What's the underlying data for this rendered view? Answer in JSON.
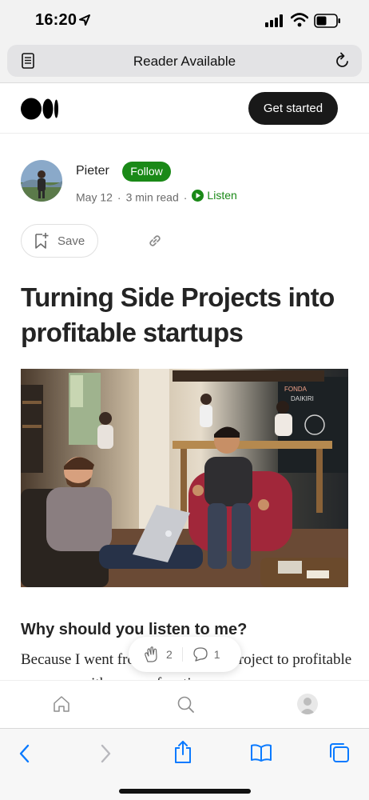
{
  "status_bar": {
    "time": "16:20",
    "icons": [
      "location-arrow-icon",
      "cellular-signal-icon",
      "wifi-icon",
      "battery-icon"
    ]
  },
  "address_bar": {
    "text": "Reader Available",
    "left_icon": "reader-icon",
    "right_icon": "reload-icon"
  },
  "header": {
    "logo_icon": "medium-logo-icon",
    "cta_label": "Get started",
    "colors": {
      "cta_bg": "#191919",
      "cta_text": "#ffffff"
    }
  },
  "author": {
    "name": "Pieter",
    "follow_label": "Follow",
    "date": "May 12",
    "read_time": "3 min read",
    "separator": "·",
    "listen_label": "Listen",
    "colors": {
      "accent": "#1a8917",
      "meta": "#6b6b6b"
    }
  },
  "actions": {
    "save_label": "Save",
    "save_icon": "bookmark-add-icon",
    "link_icon": "link-icon"
  },
  "article": {
    "title": "Turning Side Projects into profitable startups",
    "section_heading": "Why should you listen to me?",
    "body_preview": "Because I went from a hobby side project to profitable company with users a few times now"
  },
  "engagement": {
    "claps": "2",
    "responses": "1",
    "clap_icon": "clap-icon",
    "response_icon": "comment-icon"
  },
  "bottom_nav": {
    "items": [
      "home-icon",
      "search-icon",
      "profile-avatar"
    ]
  },
  "safari_toolbar": {
    "items": [
      "back-icon",
      "forward-icon",
      "share-icon",
      "bookmarks-icon",
      "tabs-icon"
    ],
    "colors": {
      "active": "#0a7aff",
      "disabled": "#b8b8bd"
    }
  }
}
